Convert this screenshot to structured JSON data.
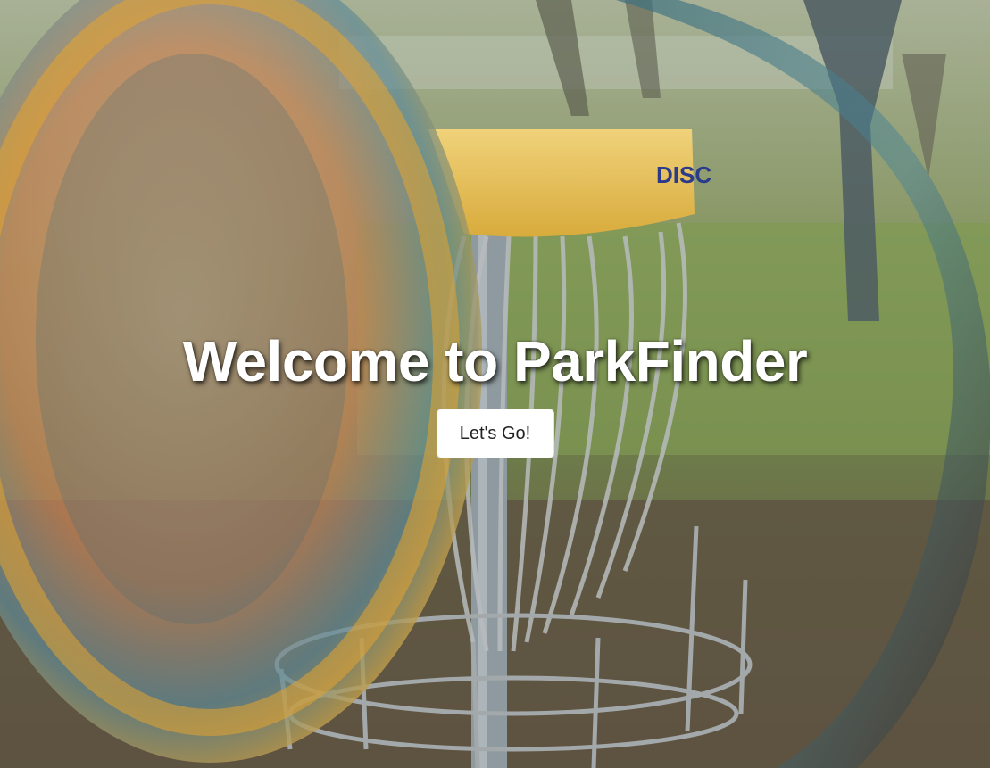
{
  "hero": {
    "title": "Welcome to ParkFinder",
    "cta_label": "Let's Go!",
    "background_description_icon": "disc-golf-basket-photo"
  },
  "colors": {
    "title_text": "#ffffff",
    "button_bg": "#ffffff",
    "button_text": "#222222",
    "basket_band": "#e9c24a"
  }
}
